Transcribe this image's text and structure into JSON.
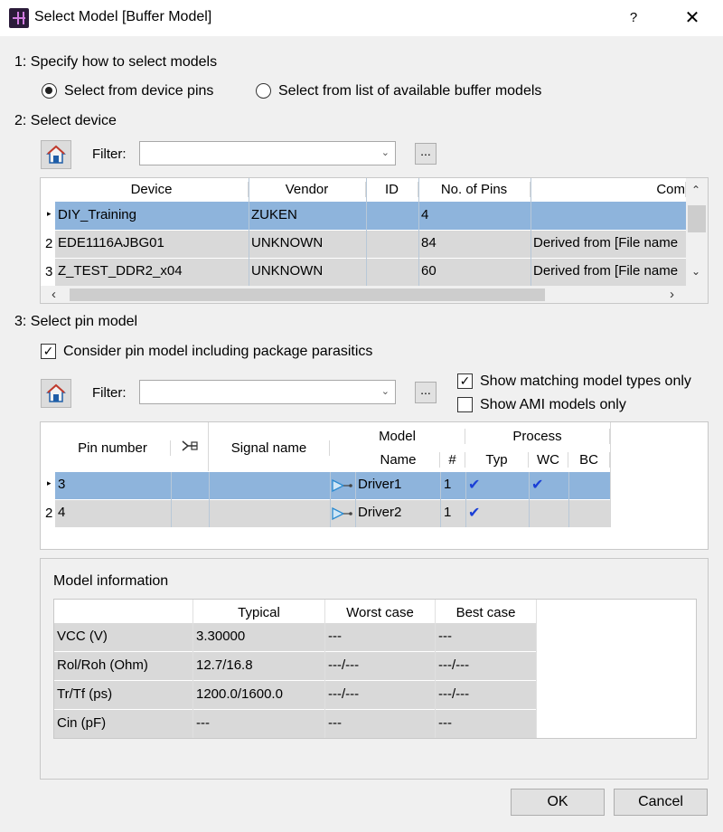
{
  "window": {
    "title": "Select Model [Buffer Model]",
    "help": "?",
    "close": "✕"
  },
  "step1": {
    "label": "1: Specify how to select models",
    "option_pins": "Select from device pins",
    "option_list": "Select from list of available buffer models",
    "selected": "pins"
  },
  "step2": {
    "label": "2: Select device",
    "filter_label": "Filter:",
    "filter_value": "",
    "dots": "...",
    "columns": [
      "Device",
      "Vendor",
      "ID",
      "No. of Pins",
      "Com"
    ],
    "rows": [
      {
        "idx": "",
        "device": "DIY_Training",
        "vendor": "ZUKEN",
        "id": "",
        "pins": "4",
        "comment": ""
      },
      {
        "idx": "2",
        "device": "EDE1116AJBG01",
        "vendor": "UNKNOWN",
        "id": "",
        "pins": "84",
        "comment": "Derived from [File name"
      },
      {
        "idx": "3",
        "device": "Z_TEST_DDR2_x04",
        "vendor": "UNKNOWN",
        "id": "",
        "pins": "60",
        "comment": "Derived from [File name"
      }
    ]
  },
  "step3": {
    "label": "3: Select pin model",
    "consider_pkg": "Consider pin model including package parasitics",
    "consider_pkg_checked": true,
    "filter_label": "Filter:",
    "filter_value": "",
    "dots": "...",
    "show_matching": "Show matching model types only",
    "show_matching_checked": true,
    "show_ami": "Show AMI models only",
    "show_ami_checked": false,
    "columns": {
      "pin_number": "Pin number",
      "signal_name": "Signal name",
      "model": "Model",
      "name": "Name",
      "hash": "#",
      "process": "Process",
      "typ": "Typ",
      "wc": "WC",
      "bc": "BC"
    },
    "rows": [
      {
        "idx": "",
        "pin": "3",
        "signal": "",
        "model_name": "Driver1",
        "count": "1",
        "typ": true,
        "wc": true,
        "bc": false
      },
      {
        "idx": "2",
        "pin": "4",
        "signal": "",
        "model_name": "Driver2",
        "count": "1",
        "typ": true,
        "wc": false,
        "bc": false
      }
    ]
  },
  "model_info": {
    "label": "Model information",
    "columns": [
      "Typical",
      "Worst case",
      "Best case"
    ],
    "rows": [
      {
        "param": "VCC (V)",
        "typical": "3.30000",
        "worst": "---",
        "best": "---"
      },
      {
        "param": "Rol/Roh (Ohm)",
        "typical": "12.7/16.8",
        "worst": "---/---",
        "best": "---/---"
      },
      {
        "param": "Tr/Tf (ps)",
        "typical": "1200.0/1600.0",
        "worst": "---/---",
        "best": "---/---"
      },
      {
        "param": "Cin (pF)",
        "typical": "---",
        "worst": "---",
        "best": "---"
      }
    ]
  },
  "footer": {
    "ok": "OK",
    "cancel": "Cancel"
  },
  "colors": {
    "selection": "#8eb4dc",
    "row_gray": "#d9d9d9",
    "check_blue": "#1a3fd6"
  }
}
